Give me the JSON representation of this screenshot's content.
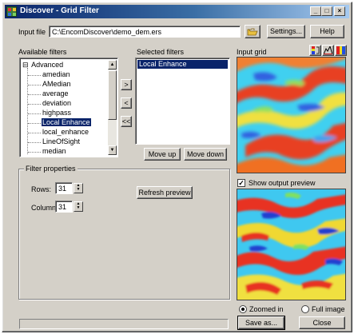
{
  "window": {
    "title": "Discover - Grid Filter",
    "controls": {
      "minimize": "_",
      "maximize": "□",
      "close": "×"
    }
  },
  "input_file": {
    "label": "Input file",
    "value": "C:\\EncomDiscover\\demo_dem.ers",
    "open_icon": "folder-open-icon"
  },
  "toolbar": {
    "settings_label": "Settings...",
    "help_label": "Help"
  },
  "available_filters": {
    "label": "Available filters",
    "root": {
      "expander": "⊟",
      "label": "Advanced"
    },
    "items": [
      "amedian",
      "AMedian",
      "average",
      "deviation",
      "highpass",
      "Local Enhance",
      "local_enhance",
      "LineOfSight",
      "median"
    ],
    "selected_index": 5
  },
  "transfer": {
    "add": ">",
    "remove": "<",
    "clear": "<<"
  },
  "selected_filters": {
    "label": "Selected filters",
    "items": [
      "Local Enhance"
    ]
  },
  "order": {
    "move_up": "Move up",
    "move_down": "Move down"
  },
  "filter_properties": {
    "title": "Filter properties",
    "rows_label": "Rows:",
    "rows_value": "31",
    "columns_label": "Columns:",
    "columns_value": "31",
    "refresh_label": "Refresh preview"
  },
  "preview": {
    "input_grid_label": "Input grid",
    "icons": [
      "color-bar-icon",
      "histogram-icon",
      "color-scheme-icon"
    ],
    "show_output_label": "Show output preview",
    "show_output_checked": true,
    "zoomed_in_label": "Zoomed in",
    "full_image_label": "Full image",
    "zoom_mode": "zoomed-in",
    "colors": {
      "low": "#3050e0",
      "mid_low": "#40c8f0",
      "mid": "#80e060",
      "mid_high": "#f0e040",
      "high": "#f05020"
    }
  },
  "footer": {
    "save_label": "Save as...",
    "close_label": "Close"
  }
}
